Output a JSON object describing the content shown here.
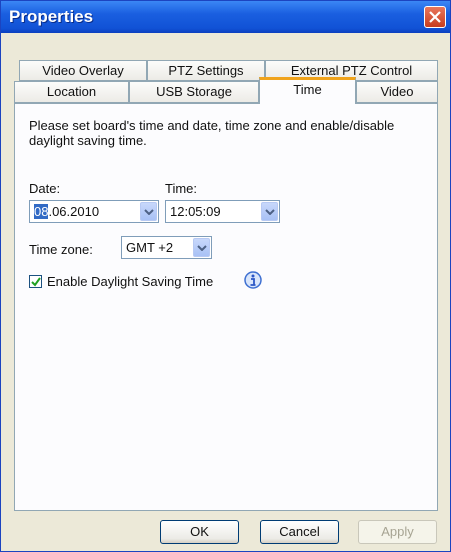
{
  "window": {
    "title": "Properties"
  },
  "tabs": {
    "row1": [
      "Video Overlay",
      "PTZ Settings",
      "External PTZ Control"
    ],
    "row2": [
      "Location",
      "USB Storage",
      "Time",
      "Video"
    ],
    "active": "Time"
  },
  "time_tab": {
    "description": "Please set board's time and date, time zone and enable/disable daylight saving time.",
    "date_label": "Date:",
    "date_value_selected": "08",
    "date_value_rest": ".06.2010",
    "time_label": "Time:",
    "time_value": "12:05:09",
    "timezone_label": "Time zone:",
    "timezone_value": "GMT +2",
    "dst_label": "Enable Daylight Saving Time",
    "dst_checked": true
  },
  "buttons": {
    "ok": "OK",
    "cancel": "Cancel",
    "apply": "Apply"
  },
  "colors": {
    "titlebar": "#1152d6",
    "active_tab_accent": "#f0a31b",
    "selection": "#316ac5"
  },
  "icons": [
    "close-icon",
    "chevron-down-icon",
    "checkmark-icon",
    "info-icon"
  ]
}
